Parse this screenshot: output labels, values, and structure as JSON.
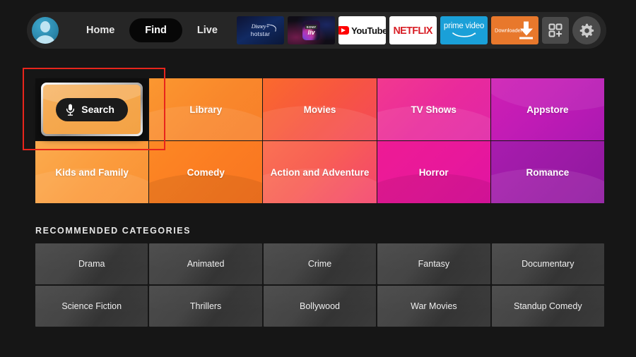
{
  "header": {
    "avatar": "profile-avatar",
    "nav": [
      {
        "label": "Home",
        "active": false
      },
      {
        "label": "Find",
        "active": true
      },
      {
        "label": "Live",
        "active": false
      }
    ],
    "apps": [
      {
        "name": "disney-hotstar",
        "line1": "Disney+",
        "line2": "hotstar"
      },
      {
        "name": "sony-liv",
        "line1": "SONY",
        "line2": "liv"
      },
      {
        "name": "youtube",
        "label": "YouTube"
      },
      {
        "name": "netflix",
        "label": "NETFLIX"
      },
      {
        "name": "prime-video",
        "label": "prime video"
      },
      {
        "name": "downloader",
        "label": "Downloader"
      }
    ],
    "apps_grid_label": "apps-grid",
    "settings_label": "settings-gear"
  },
  "tiles": {
    "search": {
      "label": "Search",
      "selected": true,
      "mic_icon": "microphone-icon"
    },
    "row1": [
      {
        "label": "Library",
        "color": "#f9872b"
      },
      {
        "label": "Movies",
        "color": "#f75640"
      },
      {
        "label": "TV Shows",
        "color": "#e92a9c"
      },
      {
        "label": "Appstore",
        "color": "#bf1bb5"
      }
    ],
    "row2": [
      {
        "label": "Kids and Family",
        "color": "#fb9b3c"
      },
      {
        "label": "Comedy",
        "color": "#fb7c22"
      },
      {
        "label": "Action and Adventure",
        "color": "#f85f55"
      },
      {
        "label": "Horror",
        "color": "#e8189b"
      },
      {
        "label": "Romance",
        "color": "#9c1aa6"
      }
    ]
  },
  "recommended": {
    "heading": "RECOMMENDED CATEGORIES",
    "items": [
      {
        "label": "Drama"
      },
      {
        "label": "Animated"
      },
      {
        "label": "Crime"
      },
      {
        "label": "Fantasy"
      },
      {
        "label": "Documentary"
      },
      {
        "label": "Science Fiction"
      },
      {
        "label": "Thrillers"
      },
      {
        "label": "Bollywood"
      },
      {
        "label": "War Movies"
      },
      {
        "label": "Standup Comedy"
      }
    ]
  },
  "selection": {
    "target": "search-tile",
    "border_color": "#e8251c"
  }
}
